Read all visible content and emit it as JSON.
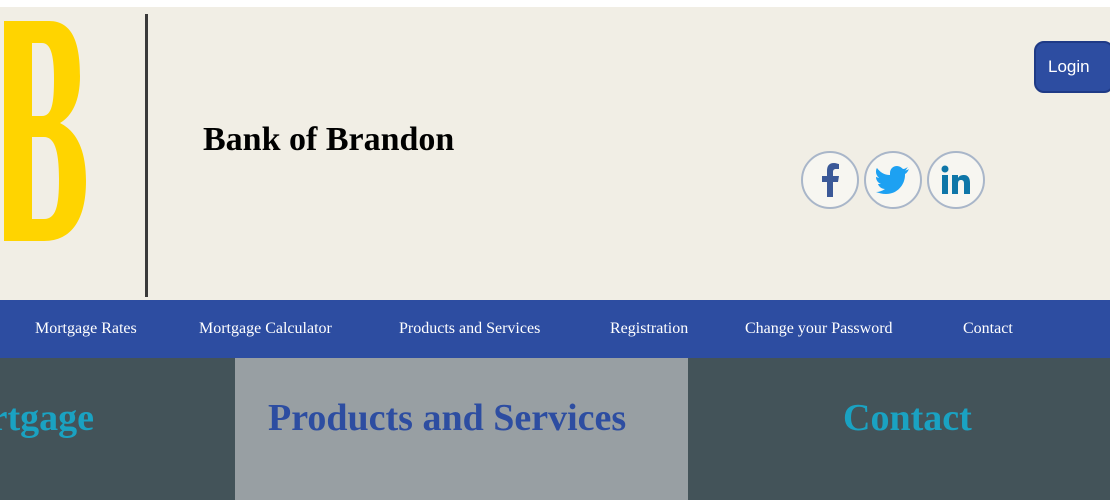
{
  "header": {
    "logo_letter": "B",
    "title": "Bank of Brandon",
    "login_label": "Login",
    "social": [
      "facebook-icon",
      "twitter-icon",
      "linkedin-icon"
    ]
  },
  "nav": {
    "items": [
      {
        "label": "Mortgage Rates"
      },
      {
        "label": "Mortgage Calculator"
      },
      {
        "label": "Products and Services"
      },
      {
        "label": "Registration"
      },
      {
        "label": "Change your Password"
      },
      {
        "label": "Contact"
      }
    ]
  },
  "panels": [
    {
      "title": "Mortgage"
    },
    {
      "title": "Products and Services"
    },
    {
      "title": "Contact"
    }
  ],
  "colors": {
    "header_bg": "#f1eee5",
    "nav_bg": "#2d4da1",
    "panel_dark": "#435359",
    "panel_light": "#989fa3",
    "accent_teal": "#1aa2c2",
    "logo_yellow": "#ffd400"
  }
}
